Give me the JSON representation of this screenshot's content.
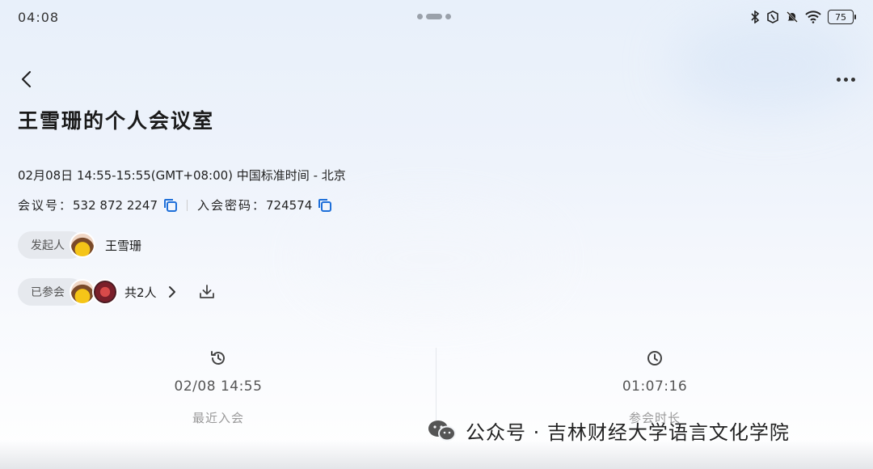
{
  "status_bar": {
    "time": "04:08",
    "battery": "75"
  },
  "meeting": {
    "title": "王雪珊的个人会议室",
    "datetime": "02月08日 14:55-15:55(GMT+08:00) 中国标准时间 - 北京",
    "id_label": "会议号：",
    "id_value": "532 872 2247",
    "password_label": "入会密码：",
    "password_value": "724574"
  },
  "host": {
    "chip_label": "发起人",
    "name": "王雪珊"
  },
  "participants": {
    "chip_label": "已参会",
    "count_text": "共2人"
  },
  "stats": [
    {
      "icon": "history-clock-icon",
      "value": "02/08 14:55",
      "label": "最近入会"
    },
    {
      "icon": "clock-icon",
      "value": "01:07:16",
      "label": "参会时长"
    }
  ],
  "watermark": {
    "text": "公众号 · 吉林财经大学语言文化学院"
  },
  "colors": {
    "accent": "#1e6fd9",
    "chip_bg": "#e6e9ee"
  }
}
